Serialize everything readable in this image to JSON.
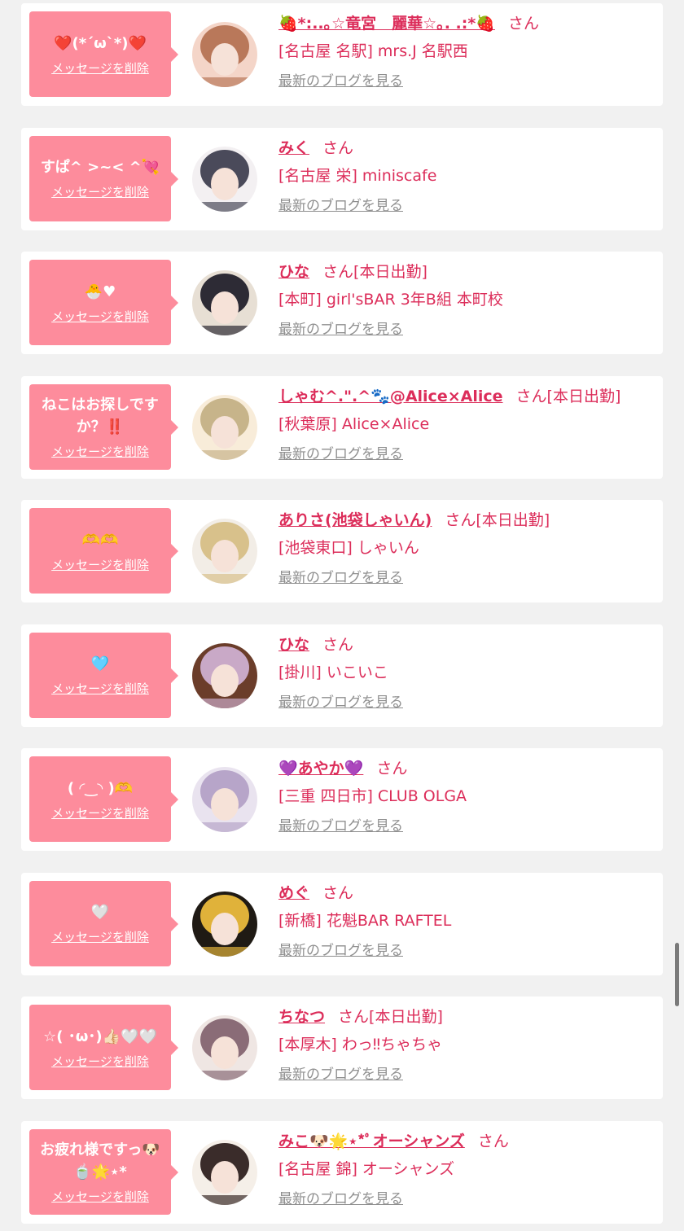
{
  "colors": {
    "background": "#f1f1f1",
    "card": "#ffffff",
    "bubble": "#fd8c9c",
    "accent": "#dc2d5a",
    "link_gray": "#8f8f8f"
  },
  "labels": {
    "delete": "メッセージを削除",
    "blog": "最新のブログを見る",
    "san": "さん"
  },
  "entries": [
    {
      "message": "❤️(*´ω`*)❤️",
      "name": "🍓*:..｡☆竜宮　麗華☆｡. .:*🍓",
      "status": "",
      "shop": "[名古屋 名駅] mrs.J 名駅西",
      "avatar": "avatar-photo"
    },
    {
      "message": "すぱ^ >~< ^💘",
      "name": "みく",
      "status": "",
      "shop": "[名古屋 栄] miniscafe",
      "avatar": "avatar-photo"
    },
    {
      "message": "🐣♥",
      "name": "ひな",
      "status": "[本日出勤]",
      "shop": "[本町] girl'sBAR 3年B組 本町校",
      "avatar": "avatar-photo"
    },
    {
      "message": "ねこはお探しです\nか？‼️",
      "name": "しゃむ^.\".^🐾@Alice×Alice",
      "status": "[本日出勤]",
      "shop": "[秋葉原] Alice×Alice",
      "avatar": "avatar-photo"
    },
    {
      "message": "🫶🫶",
      "name": "ありさ(池袋しゃいん)",
      "status": "[本日出勤]",
      "shop": "[池袋東口] しゃいん",
      "avatar": "avatar-photo"
    },
    {
      "message": "🩵",
      "name": "ひな",
      "status": "",
      "shop": "[掛川] いこいこ",
      "avatar": "avatar-photo"
    },
    {
      "message": "( ◜‿◝ )🫶",
      "name": "💜あやか💜",
      "status": "",
      "shop": "[三重 四日市] CLUB OLGA",
      "avatar": "avatar-photo"
    },
    {
      "message": "🤍",
      "name": "めぐ",
      "status": "",
      "shop": "[新橋] 花魁BAR RAFTEL",
      "avatar": "avatar-photo"
    },
    {
      "message": "☆( ･ω･)👍🏻🤍🤍",
      "name": "ちなつ",
      "status": "[本日出勤]",
      "shop": "[本厚木] わっ‼ちゃちゃ",
      "avatar": "avatar-photo"
    },
    {
      "message": "お疲れ様ですっ🐶\n🍵🌟⋆*",
      "name": "みこ🐶🌟⋆*ﾟオーシャンズ",
      "status": "",
      "shop": "[名古屋 錦] オーシャンズ",
      "avatar": "avatar-photo"
    }
  ]
}
